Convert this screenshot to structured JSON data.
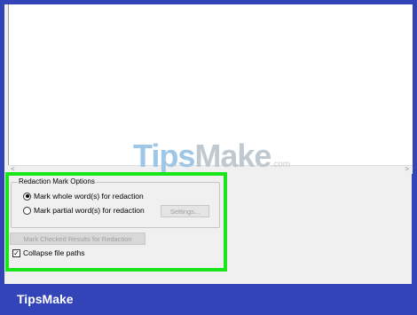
{
  "options": {
    "group_title": "Redaction Mark Options",
    "radio_whole": "Mark whole word(s) for redaction",
    "radio_partial": "Mark partial word(s) for redaction",
    "settings_button": "Settings...",
    "mark_button": "Mark Checked Results for Redaction",
    "collapse_label": "Collapse file paths",
    "selected_option": "whole",
    "collapse_checked": true
  },
  "watermark": {
    "part1": "Tips",
    "part2": "Make",
    "suffix": ".com"
  },
  "footer": {
    "brand": "TipsMake"
  },
  "colors": {
    "frame": "#3344b8",
    "highlight": "#19e619"
  }
}
